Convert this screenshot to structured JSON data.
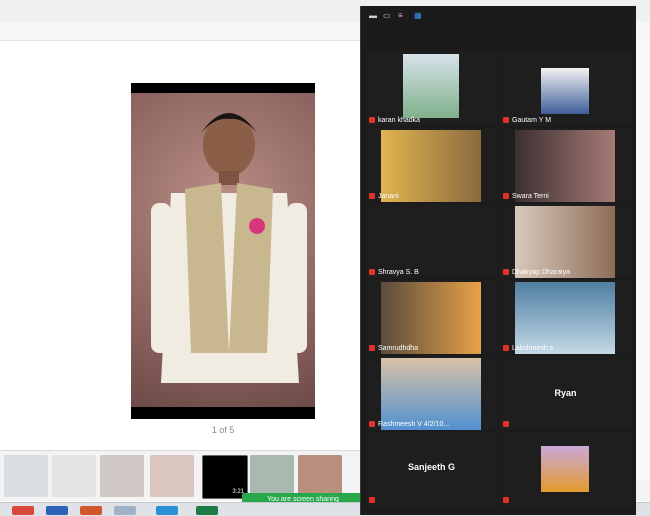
{
  "viewer": {
    "page_counter": "1 of 5",
    "video_time": "3:21"
  },
  "screen_share": {
    "badge": "You are screen sharing"
  },
  "participants": [
    {
      "name": "karan khadka",
      "muted": true,
      "video": true
    },
    {
      "name": "Gautam Y M",
      "muted": true,
      "video": true
    },
    {
      "name": "Janani",
      "muted": true,
      "video": true
    },
    {
      "name": "Swara Terni",
      "muted": true,
      "video": true
    },
    {
      "name": "Shravya S. B",
      "muted": true,
      "video": false
    },
    {
      "name": "Dhairyap Dharaiya",
      "muted": true,
      "video": true
    },
    {
      "name": "Samrudhdha",
      "muted": true,
      "video": true
    },
    {
      "name": "Lakshmesh.s",
      "muted": true,
      "video": true
    },
    {
      "name": "Rashmeesh V 4/2/10...",
      "muted": true,
      "video": true
    },
    {
      "name": "Ryan",
      "muted": true,
      "video": false
    },
    {
      "name": "Sanjeeth G",
      "muted": true,
      "video": false
    },
    {
      "name": "",
      "muted": true,
      "video": true
    }
  ],
  "colors": {
    "panel_bg": "#1b1b1b",
    "mute_red": "#e0312d",
    "share_green": "#27a84a"
  },
  "icons": [
    "speaker-view-icon",
    "gallery-view-icon",
    "mic-muted-icon"
  ]
}
